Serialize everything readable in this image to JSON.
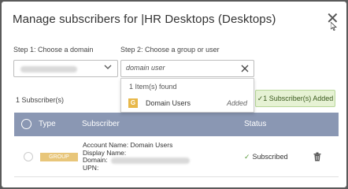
{
  "dialog": {
    "title": "Manage subscribers for |HR Desktops (Desktops)",
    "close_glyph": "✕"
  },
  "step1": {
    "label": "Step 1: Choose a domain",
    "chevron_icon": "chevron-down-icon"
  },
  "step2": {
    "label": "Step 2: Choose a group or user",
    "search_value": "domain user",
    "clear_icon": "clear-icon"
  },
  "dropdown": {
    "found_text": "1 Item(s) found",
    "results": [
      {
        "badge": "G",
        "name": "Domain Users",
        "state": "Added"
      }
    ]
  },
  "subscribers": {
    "count_text": "1 Subscriber(s)",
    "added_badge": "1 Subscriber(s) Added"
  },
  "table": {
    "headers": {
      "type": "Type",
      "subscriber": "Subscriber",
      "status": "Status"
    },
    "rows": [
      {
        "type_badge": "GROUP",
        "account_name_label": "Account Name:",
        "account_name": "Domain Users",
        "display_name_label": "Display Name:",
        "domain_label": "Domain:",
        "upn_label": "UPN:",
        "status": "Subscribed"
      }
    ]
  },
  "colors": {
    "header_bg": "#8a97b3",
    "group_badge": "#e8c67a",
    "success": "#5a9a3c"
  }
}
